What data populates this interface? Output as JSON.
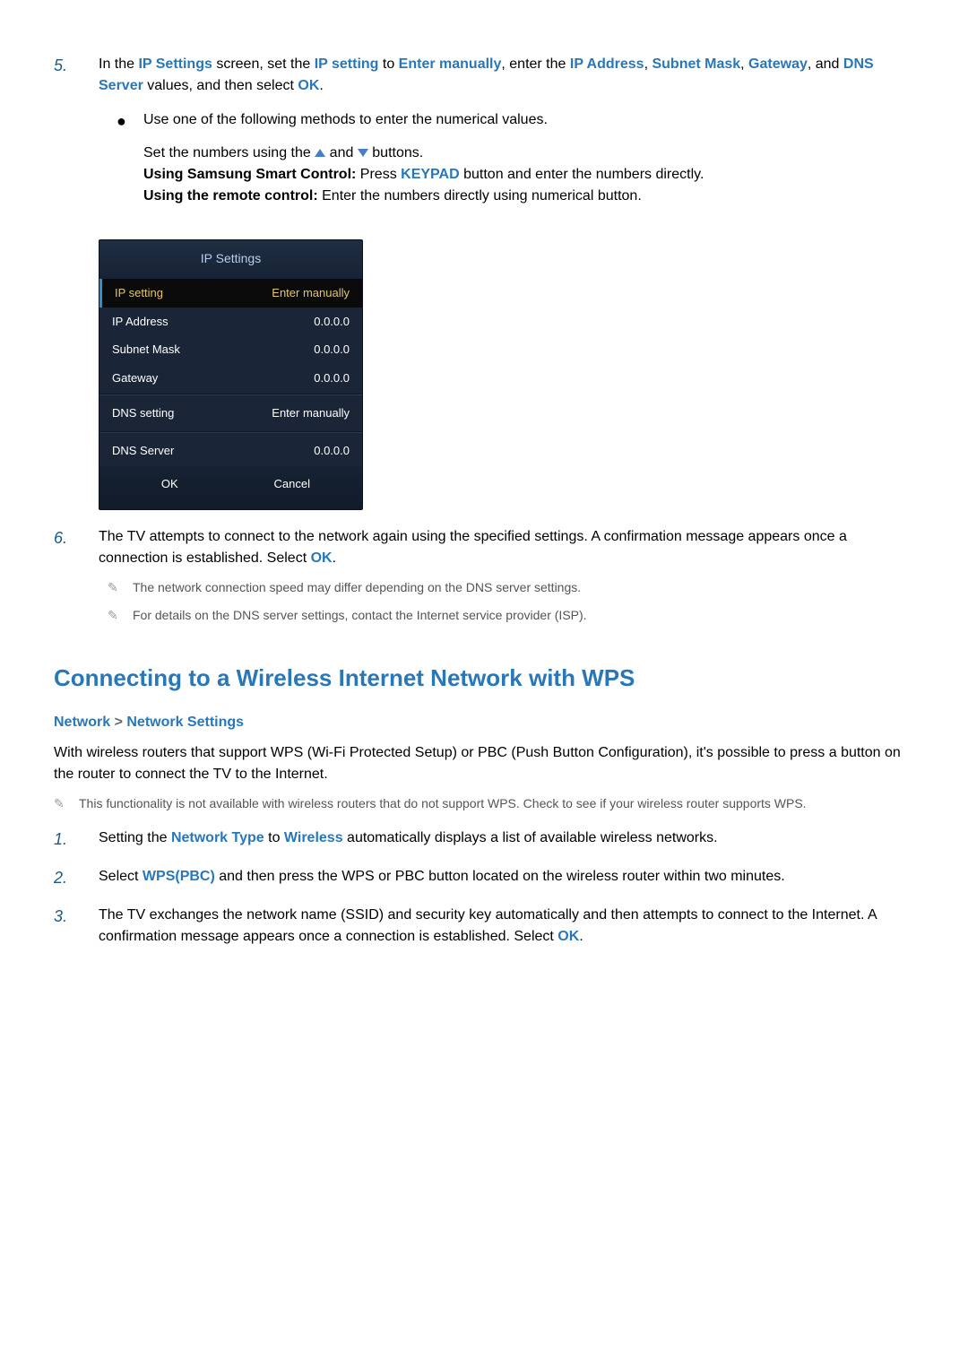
{
  "step5": {
    "num": "5.",
    "text_parts": {
      "a": "In the ",
      "b": "IP Settings",
      "c": " screen, set the ",
      "d": "IP setting",
      "e": " to ",
      "f": "Enter manually",
      "g": ", enter the ",
      "h": "IP Address",
      "i": ", ",
      "j": "Subnet Mask",
      "k": ", ",
      "l": "Gateway",
      "m": ", and ",
      "n": "DNS Server",
      "o": " values, and then select ",
      "p": "OK",
      "q": "."
    },
    "bullet_intro": "Use one of the following methods to enter the numerical values.",
    "methods": {
      "line1a": "Set the numbers using the ",
      "line1b": " and ",
      "line1c": " buttons.",
      "line2a": "Using Samsung Smart Control:",
      "line2b": " Press ",
      "line2c": "KEYPAD",
      "line2d": " button and enter the numbers directly.",
      "line3a": "Using the remote control:",
      "line3b": " Enter the numbers directly using numerical button."
    }
  },
  "ipPanel": {
    "title": "IP Settings",
    "rows": [
      {
        "label": "IP setting",
        "value": "Enter manually",
        "selected": true
      },
      {
        "label": "IP Address",
        "value": "0.0.0.0"
      },
      {
        "label": "Subnet Mask",
        "value": "0.0.0.0"
      },
      {
        "label": "Gateway",
        "value": "0.0.0.0"
      }
    ],
    "dns_setting": {
      "label": "DNS setting",
      "value": "Enter manually"
    },
    "dns_server": {
      "label": "DNS Server",
      "value": "0.0.0.0"
    },
    "ok": "OK",
    "cancel": "Cancel"
  },
  "step6": {
    "num": "6.",
    "text_a": "The TV attempts to connect to the network again using the specified settings. A confirmation message appears once a connection is established. Select ",
    "text_b": "OK",
    "text_c": ".",
    "note1": "The network connection speed may differ depending on the DNS server settings.",
    "note2": "For details on the DNS server settings, contact the Internet service provider (ISP)."
  },
  "wps": {
    "heading": "Connecting to a Wireless Internet Network with WPS",
    "bc1": "Network",
    "bc_sep": " > ",
    "bc2": "Network Settings",
    "intro": "With wireless routers that support WPS (Wi-Fi Protected Setup) or PBC (Push Button Configuration), it's possible to press a button on the router to connect the TV to the Internet.",
    "note": "This functionality is not available with wireless routers that do not support WPS. Check to see if your wireless router supports WPS.",
    "step1": {
      "num": "1.",
      "a": "Setting the ",
      "b": "Network Type",
      "c": " to ",
      "d": "Wireless",
      "e": " automatically displays a list of available wireless networks."
    },
    "step2": {
      "num": "2.",
      "a": "Select ",
      "b": "WPS(PBC)",
      "c": " and then press the WPS or PBC button located on the wireless router within two minutes."
    },
    "step3": {
      "num": "3.",
      "a": "The TV exchanges the network name (SSID) and security key automatically and then attempts to connect to the Internet. A confirmation message appears once a connection is established. Select ",
      "b": "OK",
      "c": "."
    }
  },
  "pencil": "✎"
}
